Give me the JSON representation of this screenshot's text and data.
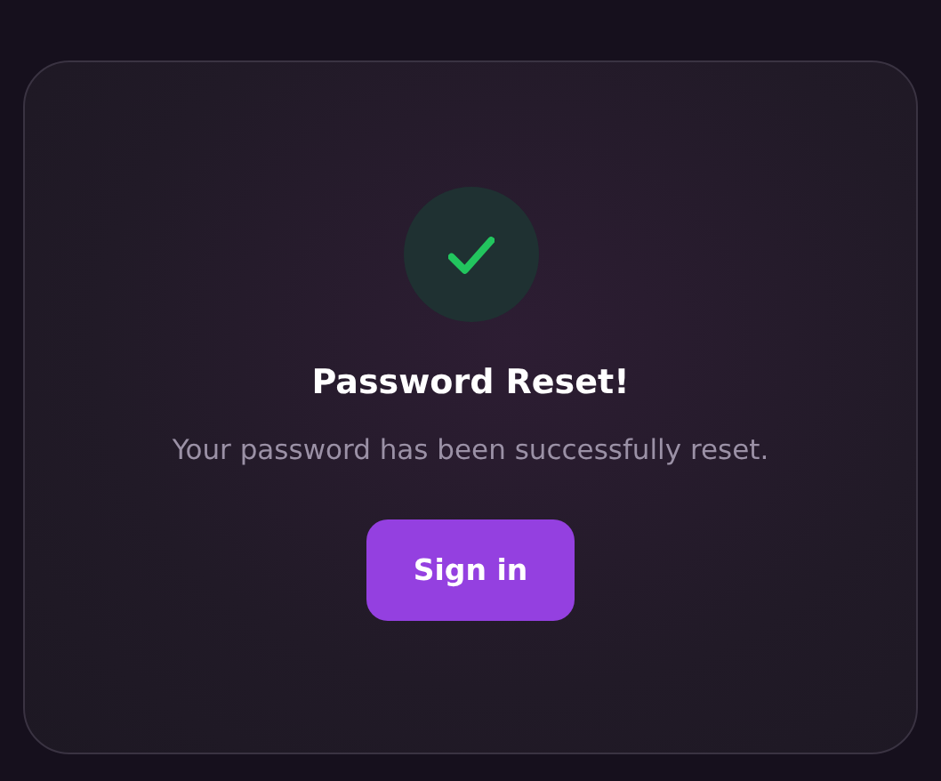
{
  "card": {
    "badge": {
      "kind": "success"
    },
    "title": "Password Reset!",
    "message": "Your password has been successfully reset.",
    "button": "Sign in"
  }
}
